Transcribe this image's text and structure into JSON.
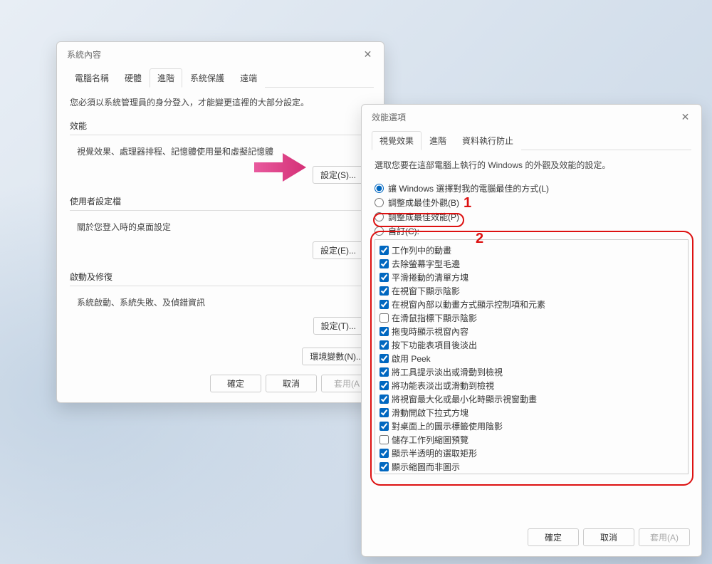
{
  "sysprops": {
    "title": "系統內容",
    "tabs": [
      {
        "label": "電腦名稱"
      },
      {
        "label": "硬體"
      },
      {
        "label": "進階",
        "active": true
      },
      {
        "label": "系統保護"
      },
      {
        "label": "遠端"
      }
    ],
    "hint": "您必須以系統管理員的身分登入，才能變更這裡的大部分設定。",
    "perf": {
      "title": "效能",
      "desc": "視覺效果、處理器排程、記憶體使用量和虛擬記憶體",
      "button": "設定(S)..."
    },
    "profiles": {
      "title": "使用者設定檔",
      "desc": "關於您登入時的桌面設定",
      "button": "設定(E)..."
    },
    "startup": {
      "title": "啟動及修復",
      "desc": "系統啟動、系統失敗、及偵錯資訊",
      "button": "設定(T)..."
    },
    "env_button": "環境變數(N)...",
    "actions": {
      "ok": "確定",
      "cancel": "取消",
      "apply": "套用(A"
    }
  },
  "perf": {
    "title": "效能選項",
    "tabs": [
      {
        "label": "視覺效果",
        "active": true
      },
      {
        "label": "進階"
      },
      {
        "label": "資料執行防止"
      }
    ],
    "hint": "選取您要在這部電腦上執行的 Windows 的外觀及效能的設定。",
    "radios": {
      "auto": "讓 Windows 選擇對我的電腦最佳的方式(L)",
      "best_look": "調整成最佳外觀(B)",
      "best_perf": "調整成最佳效能(P)",
      "custom": "自訂(C):",
      "selected": "auto"
    },
    "checks": [
      {
        "label": "工作列中的動畫",
        "checked": true
      },
      {
        "label": "去除螢幕字型毛邊",
        "checked": true
      },
      {
        "label": "平滑捲動的清單方塊",
        "checked": true
      },
      {
        "label": "在視窗下顯示陰影",
        "checked": true
      },
      {
        "label": "在視窗內部以動畫方式顯示控制項和元素",
        "checked": true
      },
      {
        "label": "在滑鼠指標下顯示陰影",
        "checked": false
      },
      {
        "label": "拖曳時顯示視窗內容",
        "checked": true
      },
      {
        "label": "按下功能表項目後淡出",
        "checked": true
      },
      {
        "label": "啟用 Peek",
        "checked": true
      },
      {
        "label": "將工具提示淡出或滑動到檢視",
        "checked": true
      },
      {
        "label": "將功能表淡出或滑動到檢視",
        "checked": true
      },
      {
        "label": "將視窗最大化或最小化時顯示視窗動畫",
        "checked": true
      },
      {
        "label": "滑動開啟下拉式方塊",
        "checked": true
      },
      {
        "label": "對桌面上的圖示標籤使用陰影",
        "checked": true
      },
      {
        "label": "儲存工作列縮圖預覽",
        "checked": false
      },
      {
        "label": "顯示半透明的選取矩形",
        "checked": true
      },
      {
        "label": "顯示縮圖而非圖示",
        "checked": true
      }
    ],
    "actions": {
      "ok": "確定",
      "cancel": "取消",
      "apply": "套用(A)"
    },
    "annotations": {
      "num1": "1",
      "num2": "2"
    }
  }
}
